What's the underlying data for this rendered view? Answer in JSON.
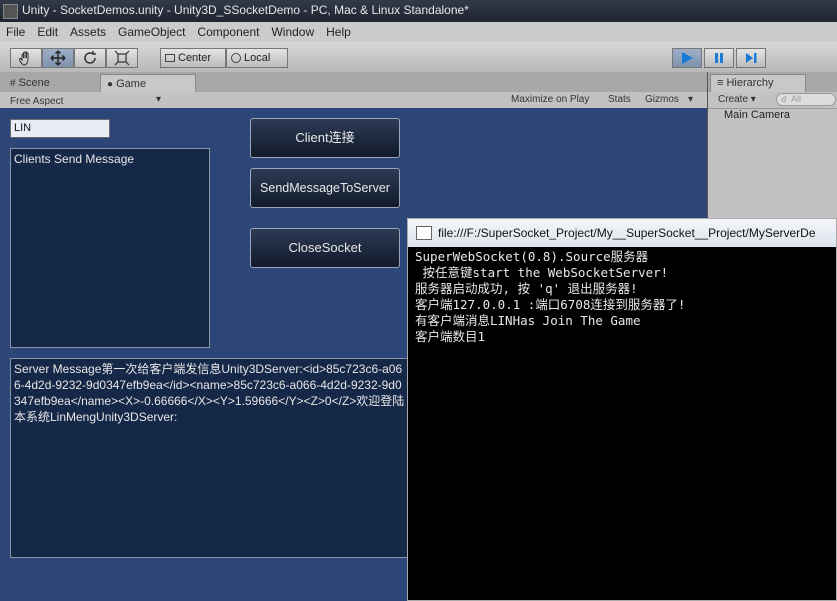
{
  "window": {
    "title": "Unity - SocketDemos.unity - Unity3D_SSocketDemo - PC, Mac & Linux Standalone*"
  },
  "menubar": {
    "items": [
      "File",
      "Edit",
      "Assets",
      "GameObject",
      "Component",
      "Window",
      "Help"
    ]
  },
  "toolbar": {
    "pivot_label": "Center",
    "space_label": "Local",
    "play_color": "#1a7bd6"
  },
  "scene_tabs": {
    "scene": "Scene",
    "game": "Game"
  },
  "game_toolbar": {
    "aspect": "Free Aspect",
    "maximize": "Maximize on Play",
    "stats": "Stats",
    "gizmos": "Gizmos"
  },
  "game_ui": {
    "name_input": "LIN",
    "client_box": "Clients Send Message",
    "server_box": "Server Message第一次给客户端发信息Unity3DServer:<id>85c723c6-a066-4d2d-9232-9d0347efb9ea</id><name>85c723c6-a066-4d2d-9232-9d0347efb9ea</name><X>-0.66666</X><Y>1.59666</Y><Z>0</Z>欢迎登陆本系统LinMengUnity3DServer:",
    "buttons": {
      "connect": "Client连接",
      "send": "SendMessageToServer",
      "close": "CloseSocket"
    }
  },
  "hierarchy": {
    "title": "Hierarchy",
    "create": "Create",
    "search_placeholder": "All",
    "items": [
      "Main Camera"
    ]
  },
  "console": {
    "title": "file:///F:/SuperSocket_Project/My__SuperSocket__Project/MyServerDe",
    "lines": [
      "SuperWebSocket(0.8).Source服务器",
      " 按任意键start the WebSocketServer!",
      "",
      "服务器启动成功, 按 'q' 退出服务器!",
      "客户端127.0.0.1 :端口6708连接到服务器了!",
      "有客户端消息LINHas Join The Game",
      "客户端数目1"
    ]
  }
}
